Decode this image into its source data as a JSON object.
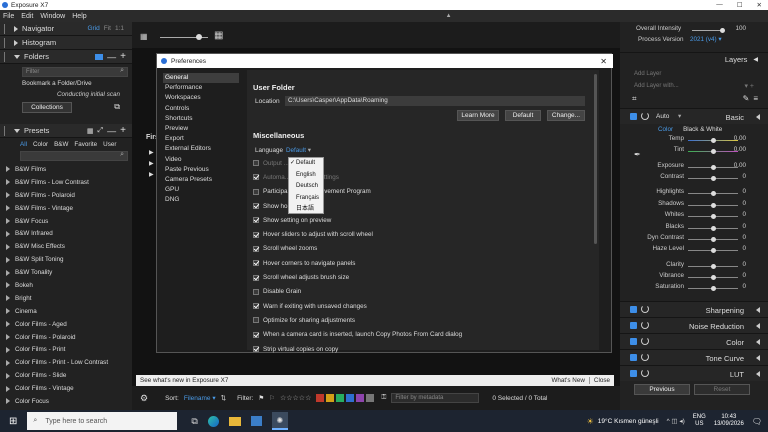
{
  "app": {
    "title": "Exposure X7"
  },
  "menu": [
    "File",
    "Edit",
    "Window",
    "Help"
  ],
  "left": {
    "navigator": {
      "label": "Navigator",
      "modes": [
        "Grid",
        "Fit",
        "1:1"
      ]
    },
    "histogram": {
      "label": "Histogram"
    },
    "folders": {
      "label": "Folders",
      "filter_placeholder": "Filter",
      "bookmark": "Bookmark a Folder/Drive",
      "status": "Conducting initial scan",
      "collections": "Collections"
    },
    "presets": {
      "label": "Presets",
      "tabs": [
        "All",
        "Color",
        "B&W",
        "Favorite",
        "User"
      ],
      "items": [
        "B&W Films",
        "B&W Films - Low Contrast",
        "B&W Films - Polaroid",
        "B&W Films - Vintage",
        "B&W Focus",
        "B&W Infrared",
        "B&W Misc Effects",
        "B&W Split Toning",
        "B&W Tonality",
        "Bokeh",
        "Bright",
        "Cinema",
        "Color Films - Aged",
        "Color Films - Polaroid",
        "Color Films - Print",
        "Color Films - Print - Low Contrast",
        "Color Films - Slide",
        "Color Films - Vintage",
        "Color Focus"
      ]
    }
  },
  "center": {
    "bg_label": "Firs",
    "bottom": {
      "sort_label": "Sort:",
      "sort_value": "Filename",
      "filter_label": "Filter:",
      "metadata_placeholder": "Filter by metadata",
      "selection": "0 Selected / 0 Total"
    },
    "status": {
      "text": "See what's new in Exposure X7",
      "whats_new": "What's New",
      "close": "Close"
    },
    "swatch_colors": [
      "#c0392b",
      "#d4a017",
      "#27ae60",
      "#2f6fd0",
      "#8e44ad",
      "#777777"
    ]
  },
  "dialog": {
    "title": "Preferences",
    "nav": [
      "General",
      "Performance",
      "Workspaces",
      "Controls",
      "Shortcuts",
      "Preview",
      "Export",
      "External Editors",
      "Video",
      "Paste Previous",
      "Camera Presets",
      "GPU",
      "DNG"
    ],
    "selected_nav": "General",
    "user_folder": {
      "heading": "User Folder",
      "location_label": "Location",
      "location_value": "C:\\Users\\Casper\\AppData\\Roaming",
      "buttons": [
        "Learn More",
        "Default",
        "Change..."
      ]
    },
    "misc": {
      "heading": "Miscellaneous",
      "language_label": "Language",
      "language_value": "Default"
    },
    "language_menu": [
      "Default",
      "English",
      "Deutsch",
      "Français",
      "日本語"
    ],
    "options": [
      {
        "label": "Output ...",
        "on": false,
        "dim": true
      },
      {
        "label": "Automa... previous settings",
        "on": true,
        "dim": true
      },
      {
        "label": "Participa... duct Improvement Program",
        "on": false,
        "dim": false
      },
      {
        "label": "Show ho...",
        "on": true,
        "dim": false
      },
      {
        "label": "Show setting on preview",
        "on": true,
        "dim": false
      },
      {
        "label": "Hover sliders to adjust with scroll wheel",
        "on": true,
        "dim": false
      },
      {
        "label": "Scroll wheel zooms",
        "on": true,
        "dim": false
      },
      {
        "label": "Hover corners to navigate panels",
        "on": true,
        "dim": false
      },
      {
        "label": "Scroll wheel adjusts brush size",
        "on": true,
        "dim": false
      },
      {
        "label": "Disable Grain",
        "on": false,
        "dim": false
      },
      {
        "label": "Warn if exiting with unsaved changes",
        "on": true,
        "dim": false
      },
      {
        "label": "Optimize for sharing adjustments",
        "on": false,
        "dim": false
      },
      {
        "label": "When a camera card is inserted, launch Copy Photos From Card dialog",
        "on": true,
        "dim": false
      },
      {
        "label": "Strip virtual copies on copy",
        "on": true,
        "dim": false
      }
    ]
  },
  "right": {
    "overall_intensity": {
      "label": "Overall Intensity",
      "value": "100"
    },
    "process_version": {
      "label": "Process Version",
      "value": "2021 (v4)"
    },
    "layers": {
      "label": "Layers",
      "add_layer": "Add Layer",
      "add_layer_with": "Add Layer with..."
    },
    "basic": {
      "auto": "Auto",
      "label": "Basic",
      "color": "Color",
      "bw": "Black & White"
    },
    "sliders": [
      {
        "label": "Temp",
        "value": "0.00",
        "pos": 0.5
      },
      {
        "label": "Tint",
        "value": "0.00",
        "pos": 0.5
      },
      {
        "label": "Exposure",
        "value": "0.00",
        "pos": 0.5
      },
      {
        "label": "Contrast",
        "value": "0",
        "pos": 0.5
      },
      {
        "label": "Highlights",
        "value": "0",
        "pos": 0.5
      },
      {
        "label": "Shadows",
        "value": "0",
        "pos": 0.5
      },
      {
        "label": "Whites",
        "value": "0",
        "pos": 0.5
      },
      {
        "label": "Blacks",
        "value": "0",
        "pos": 0.5
      },
      {
        "label": "Dyn Contrast",
        "value": "0",
        "pos": 0.5
      },
      {
        "label": "Haze Level",
        "value": "0",
        "pos": 0.5
      },
      {
        "label": "Clarity",
        "value": "0",
        "pos": 0.5
      },
      {
        "label": "Vibrance",
        "value": "0",
        "pos": 0.5
      },
      {
        "label": "Saturation",
        "value": "0",
        "pos": 0.5
      }
    ],
    "panels": [
      "Sharpening",
      "Noise Reduction",
      "Color",
      "Tone Curve",
      "LUT"
    ],
    "previous": "Previous",
    "reset": "Reset"
  },
  "taskbar": {
    "search_placeholder": "Type here to search",
    "weather": "19°C  Kısmen güneşli",
    "lang": "ENG",
    "region": "US",
    "time": "10:43",
    "date": "13/09/2026"
  }
}
